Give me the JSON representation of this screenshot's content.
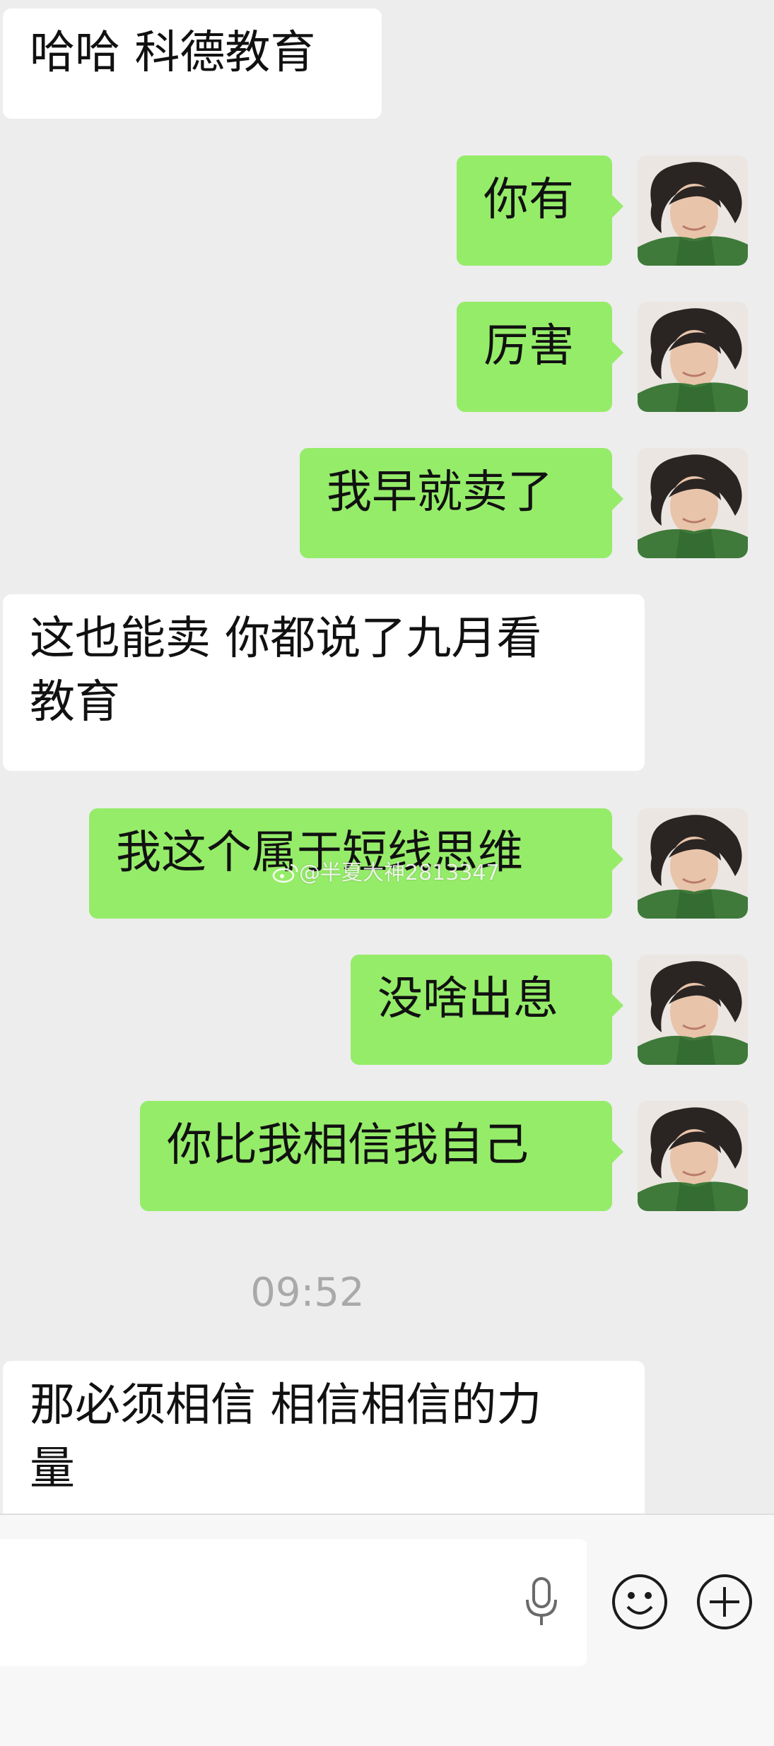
{
  "messages": [
    {
      "side": "left",
      "text": "哈哈 科德教育"
    },
    {
      "side": "right",
      "text": "你有"
    },
    {
      "side": "right",
      "text": "厉害"
    },
    {
      "side": "right",
      "text": "我早就卖了"
    },
    {
      "side": "left",
      "text": "这也能卖 你都说了九月看\n教育"
    },
    {
      "side": "right",
      "text": "我这个属于短线思维"
    },
    {
      "side": "right",
      "text": "没啥出息"
    },
    {
      "side": "right",
      "text": "你比我相信我自己"
    },
    {
      "side": "left",
      "text": "那必须相信 相信相信的力\n量"
    }
  ],
  "timestamp": "09:52",
  "watermark": "@半夏大神2813347",
  "input": {
    "value": "",
    "placeholder": ""
  },
  "icons": {
    "voice": "microphone-icon",
    "emoji": "smiley-face-icon",
    "more": "plus-circle-icon",
    "avatar": "user-avatar"
  },
  "colors": {
    "background": "#ededed",
    "sent_bubble": "#95ec69",
    "received_bubble": "#ffffff",
    "timestamp_text": "#a9a9a9",
    "input_bar": "#f7f7f7"
  }
}
